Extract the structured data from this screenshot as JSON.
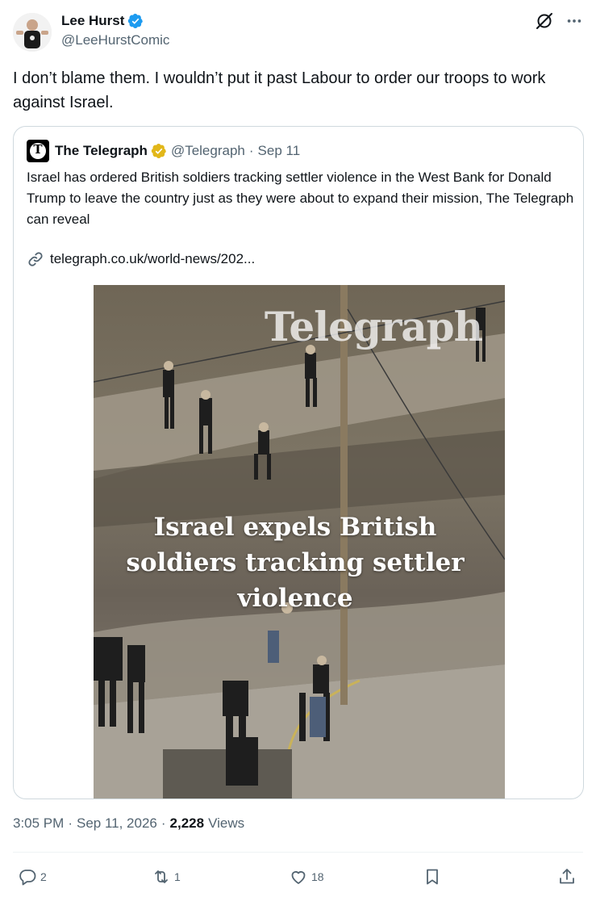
{
  "author": {
    "name": "Lee Hurst",
    "handle": "@LeeHurstComic"
  },
  "tweet": {
    "text": "I don’t blame them. I wouldn’t put it past Labour to order our troops to work against Israel."
  },
  "quoted": {
    "name": "The Telegraph",
    "handle": "@Telegraph",
    "dot": "·",
    "date": "Sep 11",
    "text": "Israel has ordered British soldiers tracking settler violence in the West Bank for Donald Trump to leave the country just as they were about to expand their mission, The Telegraph can reveal",
    "link": "telegraph.co.uk/world-news/202...",
    "media": {
      "watermark": "Telegraph",
      "headline": "Israel expels British soldiers tracking settler violence"
    }
  },
  "meta": {
    "time": "3:05 PM",
    "dot": "·",
    "date": "Sep 11, 2026",
    "views_count": "2,228",
    "views_label": "Views"
  },
  "actions": {
    "replies": "2",
    "reposts": "1",
    "likes": "18"
  },
  "colors": {
    "verified_blue": "#1d9bf0",
    "verified_gold": "#e2b719",
    "secondary_text": "#536471",
    "border": "#cfd9de"
  },
  "icons": [
    "verified-badge-icon",
    "grok-icon",
    "more-icon",
    "link-icon",
    "reply-icon",
    "repost-icon",
    "like-icon",
    "bookmark-icon",
    "share-icon"
  ]
}
